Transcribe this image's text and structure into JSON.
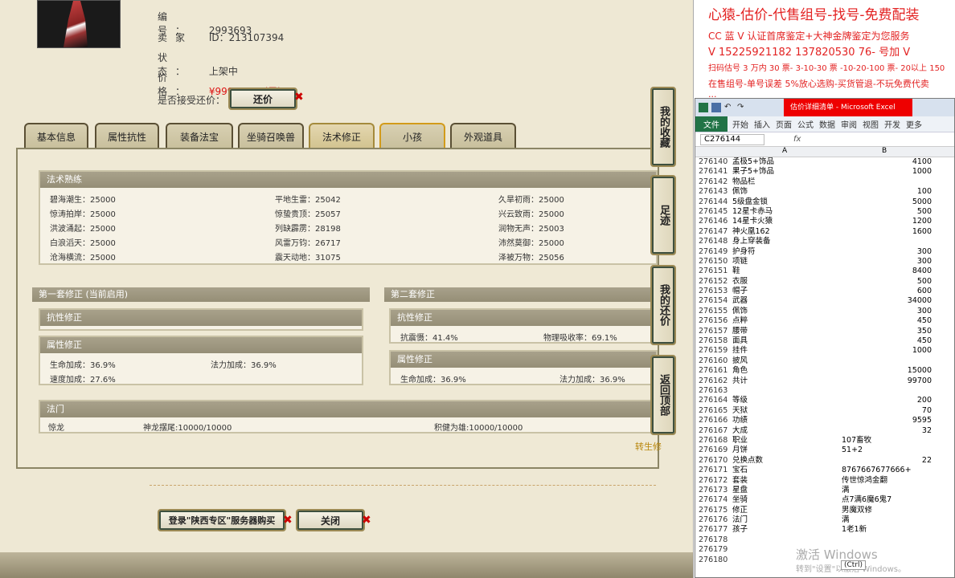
{
  "info": {
    "number_label": "编号：",
    "number_value": "2993693",
    "seller_label": "卖家",
    "seller_value": "ID：213107394",
    "status_label": "状态：",
    "status_value": "上架中",
    "price_label": "价格：",
    "price_value": "¥99999.00 (元)",
    "counter_label": "是否接受还价：",
    "counter_button": "还价"
  },
  "tabs": [
    "基本信息",
    "属性抗性",
    "装备法宝",
    "坐骑召唤兽",
    "法术修正",
    "小孩",
    "外观道具"
  ],
  "skills": {
    "title": "法术熟练",
    "rows": [
      [
        "碧海潮生：25000",
        "平地生雷：25042",
        "久旱初雨：25000"
      ],
      [
        "惊涛拍岸：25000",
        "惊蛰贵顶：25057",
        "兴云致雨：25000"
      ],
      [
        "洪波涌起：25000",
        "列缺霹雳：28198",
        "润物无声：25003"
      ],
      [
        "白浪滔天：25000",
        "风雷万钧：26717",
        "沛然莫御：25000"
      ],
      [
        "沧海横流：25000",
        "震天动地：31075",
        "泽被万物：25056"
      ]
    ]
  },
  "set1": {
    "title": "第一套修正 (当前启用)",
    "resist_title": "抗性修正",
    "attr_title": "属性修正",
    "attr_items": [
      "生命加成：36.9%",
      "法力加成：36.9%",
      "速度加成：27.6%"
    ]
  },
  "set2": {
    "title": "第二套修正",
    "resist_title": "抗性修正",
    "resist_items": [
      "抗震慑：41.4%",
      "物理吸收率：69.1%"
    ],
    "attr_title": "属性修正",
    "attr_items": [
      "生命加成：36.9%",
      "法力加成：36.9%"
    ]
  },
  "fame": {
    "title": "法门",
    "items": [
      "惊龙",
      "神龙摆尾:10000/10000",
      "积健为雄:10000/10000"
    ]
  },
  "side_buttons": [
    "我的收藏",
    "足迹",
    "我的还价",
    "返回顶部"
  ],
  "transfer_link": "转生修",
  "bottom_buttons": {
    "login": "登录\"陕西专区\"服务器购买",
    "close": "关闭"
  },
  "overlay": {
    "line1": "心猿-估价-代售组号-找号-免费配装",
    "line2": "CC 蓝 V 认证首席鉴定+大神金牌鉴定为您服务",
    "line3": "V 15225921182  137820530 76-  号加 V",
    "line4": "扫码估号 3 万内 30 票- 3-10-30 票 -10-20-100 票- 20以上 150",
    "line5": "在售组号-单号误差 5%放心选购-买货管退-不玩免费代卖",
    "line6": "..."
  },
  "excel": {
    "title": "估价详细清单 - Microsoft Excel",
    "ribbon_file": "文件",
    "ribbon_tabs": [
      "开始",
      "插入",
      "页面",
      "公式",
      "数据",
      "审阅",
      "视图",
      "开发",
      "更多"
    ],
    "name_box": "C276144",
    "fx": "fx",
    "col_a": "A",
    "col_b": "B",
    "rows": [
      [
        "276140",
        "孟极5+饰品",
        "4100"
      ],
      [
        "276141",
        "果子5+饰品",
        "1000"
      ],
      [
        "276142",
        "物品栏",
        ""
      ],
      [
        "276143",
        "佩饰",
        "100"
      ],
      [
        "276144",
        "5级盘金锁",
        "5000"
      ],
      [
        "276145",
        "12星卡赤马",
        "500"
      ],
      [
        "276146",
        "14星卡火猿",
        "1200"
      ],
      [
        "276147",
        "神火凰162",
        "1600"
      ],
      [
        "276148",
        "身上穿装备",
        ""
      ],
      [
        "276149",
        "护身符",
        "300"
      ],
      [
        "276150",
        "项链",
        "300"
      ],
      [
        "276151",
        "鞋",
        "8400"
      ],
      [
        "276152",
        "衣服",
        "500"
      ],
      [
        "276153",
        "帽子",
        "600"
      ],
      [
        "276154",
        "武器",
        "34000"
      ],
      [
        "276155",
        "佩饰",
        "300"
      ],
      [
        "276156",
        "点粹",
        "450"
      ],
      [
        "276157",
        "腰带",
        "350"
      ],
      [
        "276158",
        "面具",
        "450"
      ],
      [
        "276159",
        "挂件",
        "1000"
      ],
      [
        "276160",
        "披风",
        ""
      ],
      [
        "276161",
        "角色",
        "15000"
      ],
      [
        "276162",
        "共计",
        "99700"
      ],
      [
        "276163",
        "",
        ""
      ],
      [
        "276164",
        "等级",
        "200"
      ],
      [
        "276165",
        "天狱",
        "70"
      ],
      [
        "276166",
        "功绩",
        "9595"
      ],
      [
        "276167",
        "大成",
        "32"
      ],
      [
        "276168",
        "职业",
        "107畜牧"
      ],
      [
        "276169",
        "月饼",
        "51+2"
      ],
      [
        "276170",
        "兑换点数",
        "22"
      ],
      [
        "276171",
        "宝石",
        "8767667677666+"
      ],
      [
        "276172",
        "套装",
        "传世惊鸿金翻"
      ],
      [
        "276173",
        "星盘",
        "满"
      ],
      [
        "276174",
        "坐骑",
        "点7满6魔6鬼7"
      ],
      [
        "276175",
        "修正",
        "男魔双修"
      ],
      [
        "276176",
        "法门",
        "满"
      ],
      [
        "276177",
        "孩子",
        "1老1新"
      ],
      [
        "276178",
        "",
        ""
      ],
      [
        "276179",
        "",
        ""
      ],
      [
        "276180",
        "",
        ""
      ]
    ],
    "watermark": "激活 Windows",
    "watermark_sub": "转到\"设置\"以激活 Windows。",
    "ctrl_badge": "(Ctrl)"
  }
}
